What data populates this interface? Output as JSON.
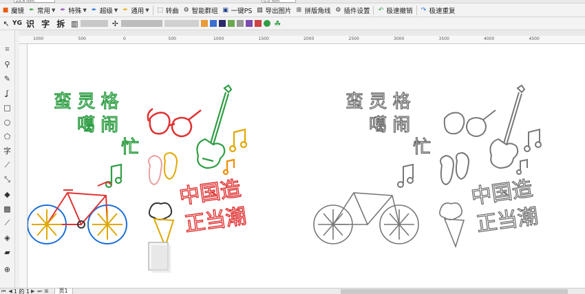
{
  "topstrip": {
    "field1": "25.4 mm",
    "field2": "0.0 mm"
  },
  "plugin_toolbar": {
    "items": [
      {
        "label": "魔镜",
        "icon": "magic-mirror-icon",
        "color": "#e85c0d",
        "dropdown": false
      },
      {
        "label": "常用",
        "icon": "pen-icon",
        "color": "#2f9e44",
        "dropdown": true
      },
      {
        "label": "特殊",
        "icon": "pen-icon",
        "color": "#8a3ab9",
        "dropdown": true
      },
      {
        "label": "超级",
        "icon": "pen-icon",
        "color": "#1c6ed6",
        "dropdown": true
      },
      {
        "label": "通用",
        "icon": "pen-icon",
        "color": "#e0a800",
        "dropdown": true
      },
      {
        "label": "转曲",
        "icon": "curve-icon",
        "color": "#333333",
        "dropdown": false
      },
      {
        "label": "智能群组",
        "icon": "group-icon",
        "color": "#333333",
        "dropdown": false
      },
      {
        "label": "一键PS",
        "icon": "ps-icon",
        "color": "#1c3f8a",
        "dropdown": false
      },
      {
        "label": "导出图片",
        "icon": "image-export-icon",
        "color": "#333333",
        "dropdown": false
      },
      {
        "label": "拼版角线",
        "icon": "cropmark-icon",
        "color": "#333333",
        "dropdown": false
      },
      {
        "label": "插件设置",
        "icon": "gear-icon",
        "color": "#333333",
        "dropdown": false
      },
      {
        "label": "极速撤销",
        "icon": "undo-icon",
        "color": "#2f9e44",
        "dropdown": false
      },
      {
        "label": "极速重复",
        "icon": "redo-icon",
        "color": "#1c6ed6",
        "dropdown": false
      }
    ]
  },
  "option_bar": {
    "text_tools": "识 字 拆"
  },
  "ruler": {
    "ticks": [
      "1000",
      "500",
      "0",
      "500",
      "1000",
      "1500",
      "2000",
      "2500",
      "3000",
      "3500",
      "4000",
      "4500"
    ]
  },
  "artwork": {
    "color_title_line1": "蛮 灵 格",
    "color_title_line2": "噶 闹",
    "color_title_line3": "忙",
    "color_slogan_line1": "中国造",
    "color_slogan_line2": "正当潮",
    "outline_title_line1": "蛮 灵 格",
    "outline_title_line2": "噶 闹",
    "outline_title_line3": "忙",
    "outline_slogan_line1": "中国造",
    "outline_slogan_line2": "正当潮"
  },
  "bottom_bar": {
    "page_counter": "1 的 1",
    "page_tab": "页1"
  }
}
